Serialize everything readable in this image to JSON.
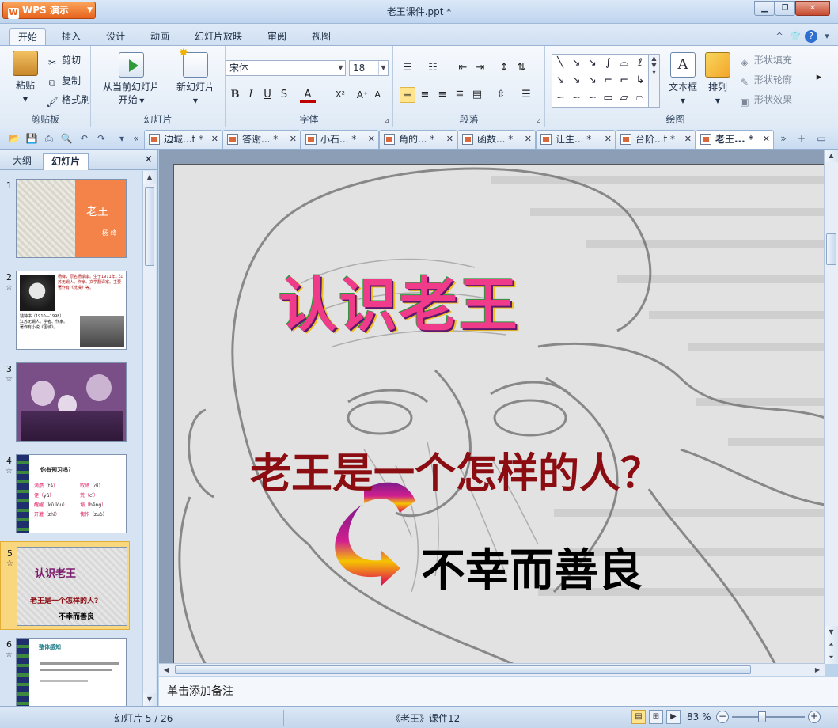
{
  "window": {
    "title": "老王课件.ppt *",
    "app_button": "WPS 演示",
    "app_logo": "W"
  },
  "ribbon_tabs": [
    "开始",
    "插入",
    "设计",
    "动画",
    "幻灯片放映",
    "审阅",
    "视图"
  ],
  "clipboard": {
    "paste": "粘贴",
    "cut": "剪切",
    "copy": "复制",
    "format_painter": "格式刷",
    "group": "剪贴板"
  },
  "slides_group": {
    "from_current": "从当前幻灯片",
    "start": "开始",
    "new_slide": "新幻灯片",
    "group": "幻灯片"
  },
  "font": {
    "name": "宋体",
    "size": "18",
    "group": "字体",
    "bold": "B",
    "italic": "I",
    "underline": "U",
    "shadow": "S",
    "color": "A",
    "superscript": "X²",
    "grow": "A⁺",
    "shrink": "A⁻"
  },
  "paragraph": {
    "group": "段落"
  },
  "drawing": {
    "textbox": "文本框",
    "arrange": "排列",
    "shape_fill": "形状填充",
    "shape_outline": "形状轮廓",
    "shape_effect": "形状效果",
    "group": "绘图"
  },
  "doc_tabs": [
    {
      "label": "边城...t *",
      "active": false
    },
    {
      "label": "答谢... *",
      "active": false
    },
    {
      "label": "小石... *",
      "active": false
    },
    {
      "label": "角的... *",
      "active": false
    },
    {
      "label": "函数... *",
      "active": false
    },
    {
      "label": "让生... *",
      "active": false
    },
    {
      "label": "台阶...t *",
      "active": false
    },
    {
      "label": "老王... *",
      "active": true
    }
  ],
  "panel": {
    "outline_tab": "大纲",
    "slides_tab": "幻灯片",
    "close": "×"
  },
  "thumbnails": [
    {
      "num": "1",
      "title": "老王",
      "subtitle": "杨 绛"
    },
    {
      "num": "2",
      "lines": [
        "杨绛，原名杨季康。生于1911年。江苏无锡人。作家、文学翻译家。主要著作有《洗澡》等。"
      ],
      "caption": "钱钟书（1910—1998）江苏无锡人。学者、作家。著作有小说《围城》。"
    },
    {
      "num": "3"
    },
    {
      "num": "4",
      "heading": "你有预习吗？",
      "words": [
        [
          "滴攒（",
          "tā",
          "）"
        ],
        [
          "取缔（",
          "dì",
          "）"
        ],
        [
          "侄（",
          "yǔ",
          "）"
        ],
        [
          "荒（",
          "cì",
          "）"
        ],
        [
          "醒醒（",
          "kǔ lóu",
          "）"
        ],
        [
          "塌（",
          "bēng",
          "）"
        ],
        [
          "开灌（",
          "zhì",
          "）"
        ],
        [
          "愧作（",
          "zuò",
          "）"
        ]
      ]
    },
    {
      "num": "5",
      "title": "认识老王",
      "question": "老王是一个怎样的人?",
      "answer": "不幸而善良"
    },
    {
      "num": "6",
      "heading": "整体感知"
    }
  ],
  "main_slide": {
    "title": "认识老王",
    "question": "老王是一个怎样的人？",
    "answer": "不幸而善良"
  },
  "notes_placeholder": "单击添加备注",
  "status": {
    "slide_pos": "幻灯片 5 / 26",
    "design": "《老王》课件12",
    "zoom": "83 %"
  },
  "colors": {
    "accent_orange": "#f4834a",
    "question_red": "#8b0d12",
    "answer_black": "#000000"
  }
}
